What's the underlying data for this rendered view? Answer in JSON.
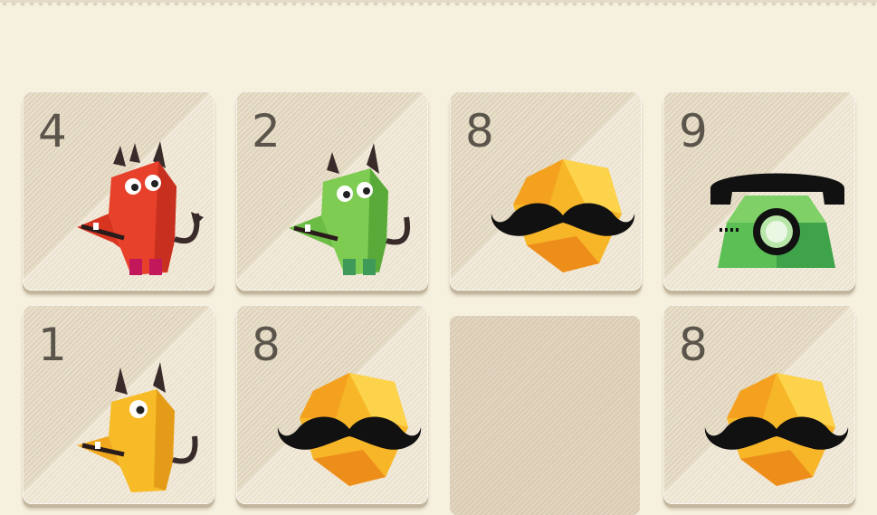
{
  "board": {
    "tiles": [
      {
        "number": "4",
        "character": "red-monster"
      },
      {
        "number": "2",
        "character": "green-monster"
      },
      {
        "number": "8",
        "character": "mustache-gem"
      },
      {
        "number": "9",
        "character": "green-telephone"
      },
      {
        "number": "1",
        "character": "yellow-monster"
      },
      {
        "number": "8",
        "character": "mustache-gem"
      },
      {
        "number": "",
        "character": "empty"
      },
      {
        "number": "8",
        "character": "mustache-gem"
      }
    ]
  },
  "colors": {
    "background": "#f6f0de",
    "tile_dark": "#e2d6bd",
    "tile_light": "#efe6d2",
    "number": "#5a544b",
    "monster_red": "#e8412b",
    "monster_green": "#76c449",
    "monster_yellow": "#f5b325",
    "gem_orange": "#f5a623",
    "phone_green": "#5bbf55"
  }
}
